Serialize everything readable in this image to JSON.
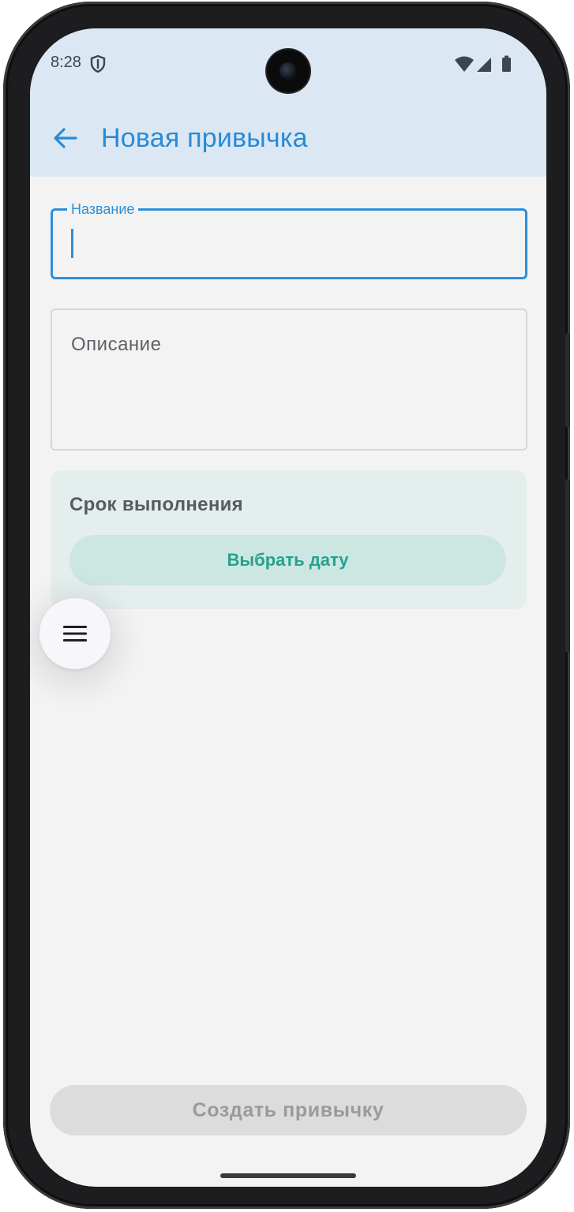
{
  "status_bar": {
    "time": "8:28",
    "icons": [
      "shield-icon",
      "wifi-icon",
      "cellular-signal-icon",
      "battery-icon"
    ]
  },
  "app_bar": {
    "back_icon": "arrow-back-icon",
    "title": "Новая привычка"
  },
  "form": {
    "name_field": {
      "label": "Название",
      "value": "",
      "focused": true
    },
    "description_field": {
      "placeholder": "Описание",
      "value": ""
    },
    "deadline": {
      "title": "Срок выполнения",
      "pick_button": "Выбрать дату"
    }
  },
  "fab": {
    "icon": "menu-icon"
  },
  "submit": {
    "label": "Создать привычку",
    "enabled": false
  },
  "colors": {
    "accent": "#2e8fd8",
    "app_bar_bg": "#dbe8f4",
    "teal": "#24a28e",
    "teal_bg": "#cce6e2",
    "card_bg": "#e4eeec",
    "disabled_bg": "#dcdcdc",
    "disabled_text": "#9a9a9a"
  }
}
